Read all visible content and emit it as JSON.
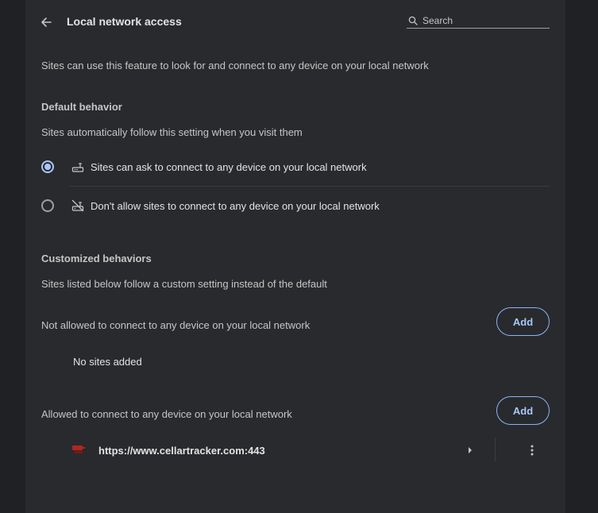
{
  "header": {
    "title": "Local network access",
    "back_icon": "arrow-back-icon",
    "search": {
      "placeholder": "Search",
      "value": "",
      "icon": "search-icon"
    }
  },
  "description": "Sites can use this feature to look for and connect to any device on your local network",
  "default_behavior": {
    "heading": "Default behavior",
    "subheading": "Sites automatically follow this setting when you visit them",
    "options": [
      {
        "label": "Sites can ask to connect to any device on your local network",
        "icon": "router-icon",
        "selected": true
      },
      {
        "label": "Don't allow sites to connect to any device on your local network",
        "icon": "router-off-icon",
        "selected": false
      }
    ]
  },
  "customized_behaviors": {
    "heading": "Customized behaviors",
    "subheading": "Sites listed below follow a custom setting instead of the default",
    "not_allowed": {
      "label": "Not allowed to connect to any device on your local network",
      "add_label": "Add",
      "empty_text": "No sites added"
    },
    "allowed": {
      "label": "Allowed to connect to any device on your local network",
      "add_label": "Add",
      "sites": [
        {
          "url": "https://www.cellartracker.com:443",
          "favicon": "cellartracker-favicon-icon"
        }
      ]
    }
  },
  "colors": {
    "accent": "#a8c7fa",
    "panel_bg": "#292a2d",
    "page_bg": "#202124",
    "favicon": "#b3261e"
  }
}
